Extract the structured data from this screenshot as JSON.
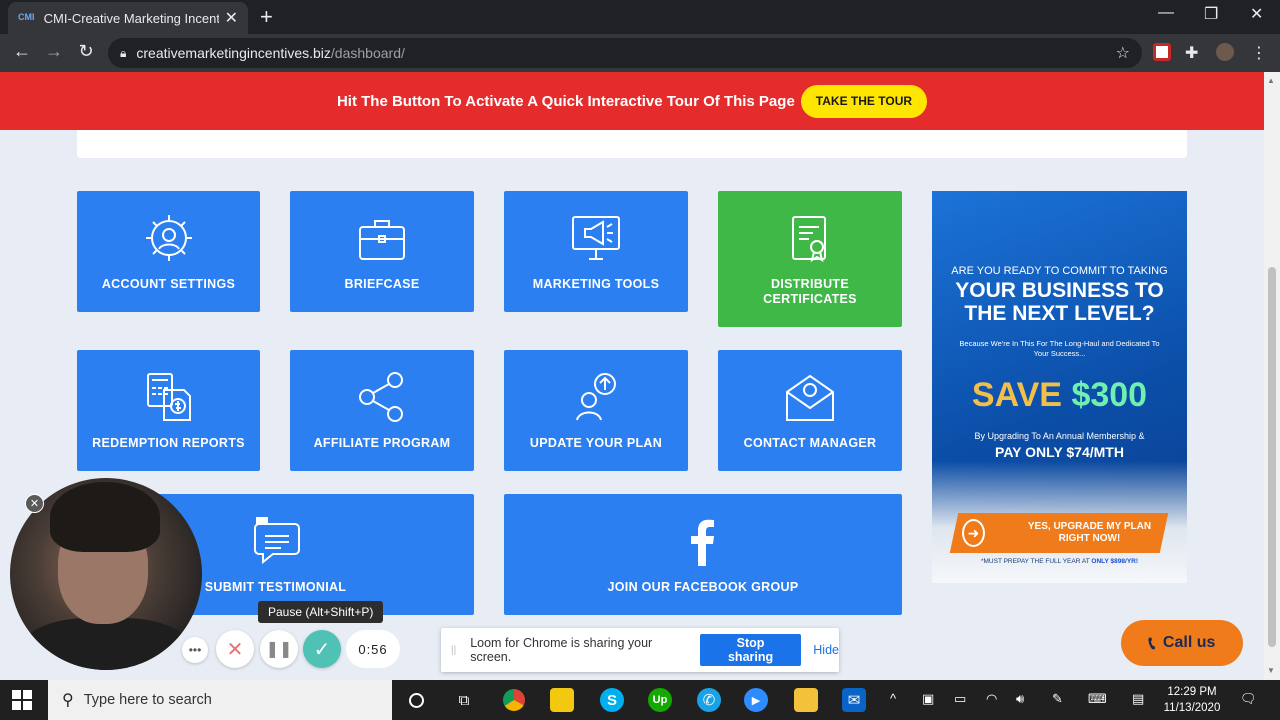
{
  "browser": {
    "tab_title": "CMI-Creative Marketing Incentives",
    "tab_favicon": "CMI",
    "url_host": "creativemarketingincentives.biz",
    "url_path": "/dashboard/",
    "new_tab": "+",
    "close": "✕",
    "minimize": "—",
    "restore": "❐",
    "close_window": "✕"
  },
  "banner": {
    "message": "Hit The Button To Activate A Quick Interactive Tour Of This Page",
    "button": "TAKE THE TOUR"
  },
  "tiles": [
    {
      "label": "ACCOUNT SETTINGS",
      "icon": "gear-user-icon"
    },
    {
      "label": "BRIEFCASE",
      "icon": "briefcase-icon"
    },
    {
      "label": "MARKETING TOOLS",
      "icon": "megaphone-monitor-icon"
    },
    {
      "label": "DISTRIBUTE CERTIFICATES",
      "icon": "certificate-icon"
    },
    {
      "label": "REDEMPTION REPORTS",
      "icon": "calculator-report-icon"
    },
    {
      "label": "AFFILIATE PROGRAM",
      "icon": "network-icon"
    },
    {
      "label": "UPDATE YOUR PLAN",
      "icon": "user-upgrade-icon"
    },
    {
      "label": "CONTACT MANAGER",
      "icon": "mail-icon"
    },
    {
      "label": "SUBMIT TESTIMONIAL",
      "icon": "quote-bubble-icon"
    },
    {
      "label": "JOIN OUR FACEBOOK GROUP",
      "icon": "facebook-icon"
    }
  ],
  "ad": {
    "line1": "ARE YOU READY TO COMMIT TO TAKING",
    "line2": "YOUR BUSINESS TO THE NEXT LEVEL?",
    "line3": "Because We're In This For The Long-Haul and Dedicated To Your Success...",
    "save_word": "SAVE",
    "save_amount": "$300",
    "line4": "By Upgrading To An Annual Membership &",
    "line5": "PAY ONLY $74/MTH",
    "cta": "YES, UPGRADE MY PLAN RIGHT NOW!",
    "fine_print": "*MUST PREPAY THE FULL YEAR AT",
    "fine_price": "ONLY $898/YR!"
  },
  "call_button": "Call us",
  "loom": {
    "tooltip": "Pause (Alt+Shift+P)",
    "timer": "0:56",
    "share_text": "Loom for Chrome is sharing your screen.",
    "stop_button": "Stop sharing",
    "hide_link": "Hide"
  },
  "taskbar": {
    "search_placeholder": "Type here to search",
    "time": "12:29 PM",
    "date": "11/13/2020"
  },
  "colors": {
    "banner_red": "#e42c2c",
    "tile_blue": "#2b7ff0",
    "tile_green": "#40b848",
    "tour_yellow": "#ffe600",
    "call_orange": "#f07b1a"
  }
}
